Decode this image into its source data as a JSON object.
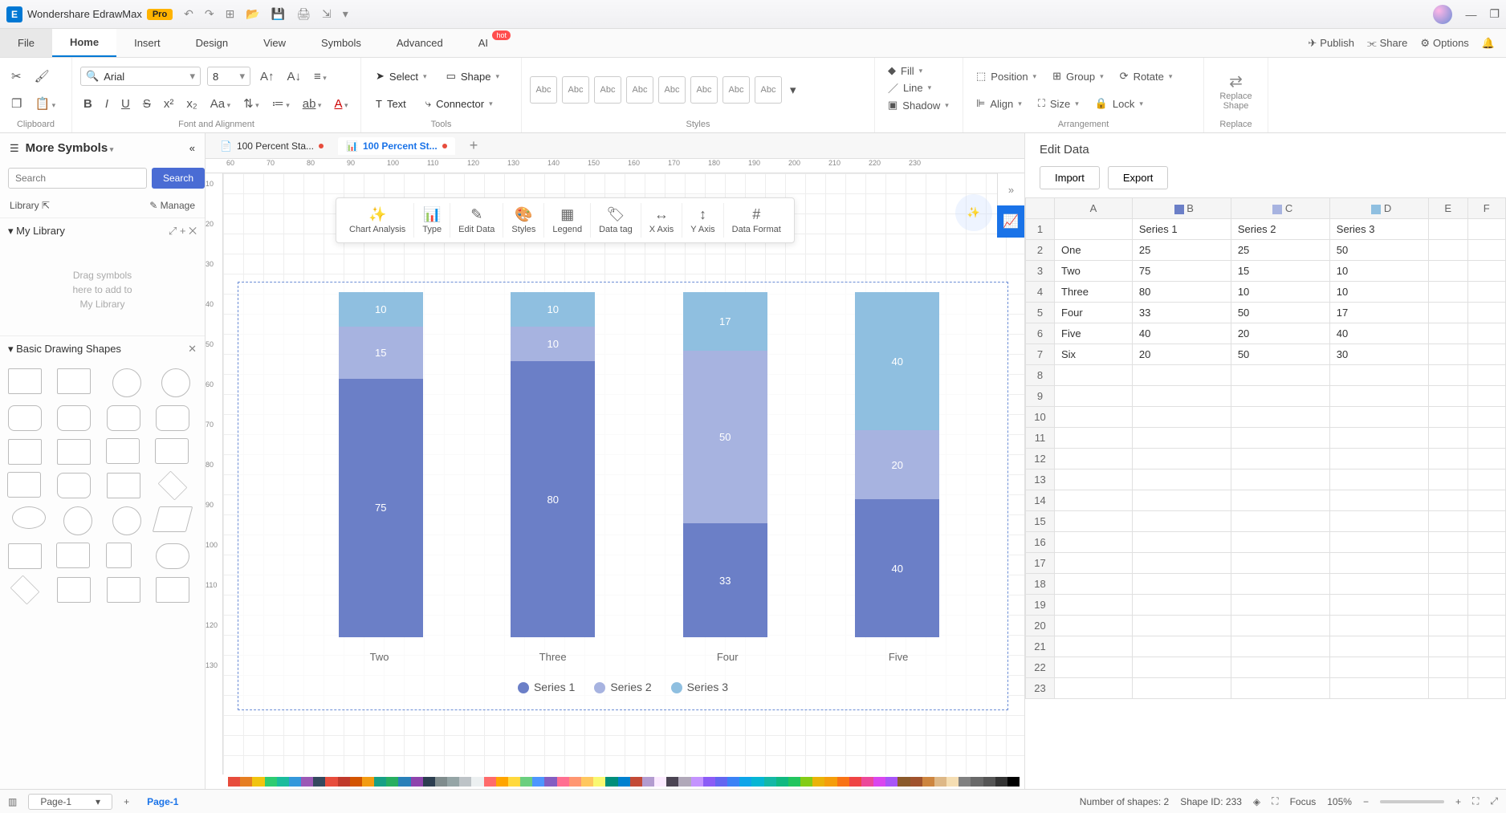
{
  "app": {
    "name": "Wondershare EdrawMax",
    "badge": "Pro"
  },
  "menu": {
    "tabs": [
      "File",
      "Home",
      "Insert",
      "Design",
      "View",
      "Symbols",
      "Advanced",
      "AI"
    ],
    "active": "Home",
    "hot": "hot",
    "right": {
      "publish": "Publish",
      "share": "Share",
      "options": "Options"
    }
  },
  "ribbon": {
    "font_name": "Arial",
    "font_size": "8",
    "select": "Select",
    "shape": "Shape",
    "text": "Text",
    "connector": "Connector",
    "style_label": "Abc",
    "fill": "Fill",
    "line": "Line",
    "shadow": "Shadow",
    "position": "Position",
    "group": "Group",
    "rotate": "Rotate",
    "align": "Align",
    "size": "Size",
    "lock": "Lock",
    "replace_shape": "Replace\nShape",
    "replace": "Replace",
    "groups": {
      "clipboard": "Clipboard",
      "font": "Font and Alignment",
      "tools": "Tools",
      "styles": "Styles",
      "arrange": "Arrangement",
      "rep": "Replace"
    }
  },
  "left": {
    "more": "More Symbols",
    "search_ph": "Search",
    "search_btn": "Search",
    "library": "Library",
    "manage": "Manage",
    "my_library": "My Library",
    "drop_hint": "Drag symbols\nhere to add to\nMy Library",
    "shapes_title": "Basic Drawing Shapes"
  },
  "docs": {
    "tab1": "100 Percent Sta...",
    "tab2": "100 Percent St..."
  },
  "chart_toolbar": [
    "Chart Analysis",
    "Type",
    "Edit Data",
    "Styles",
    "Legend",
    "Data tag",
    "X Axis",
    "Y Axis",
    "Data Format"
  ],
  "ruler_h": [
    "60",
    "70",
    "80",
    "90",
    "100",
    "110",
    "120",
    "130",
    "140",
    "150",
    "160",
    "170",
    "180",
    "190",
    "200",
    "210",
    "220",
    "230"
  ],
  "ruler_v": [
    "10",
    "20",
    "30",
    "40",
    "50",
    "60",
    "70",
    "80",
    "90",
    "100",
    "110",
    "120",
    "130"
  ],
  "chart_data": {
    "type": "stacked-bar-100",
    "categories": [
      "Two",
      "Three",
      "Four",
      "Five"
    ],
    "series": [
      {
        "name": "Series 1",
        "color": "#6b7fc7",
        "values": [
          75,
          80,
          33,
          40
        ]
      },
      {
        "name": "Series 2",
        "color": "#a7b3e0",
        "values": [
          15,
          10,
          50,
          20
        ]
      },
      {
        "name": "Series 3",
        "color": "#8fbfe0",
        "values": [
          10,
          10,
          17,
          40
        ]
      }
    ],
    "legend_position": "bottom"
  },
  "edit_panel": {
    "title": "Edit Data",
    "import": "Import",
    "export": "Export",
    "cols": [
      "A",
      "B",
      "C",
      "D",
      "E",
      "F"
    ],
    "header_row": [
      "",
      "Series 1",
      "Series 2",
      "Series 3"
    ],
    "rows": [
      [
        "One",
        "25",
        "25",
        "50"
      ],
      [
        "Two",
        "75",
        "15",
        "10"
      ],
      [
        "Three",
        "80",
        "10",
        "10"
      ],
      [
        "Four",
        "33",
        "50",
        "17"
      ],
      [
        "Five",
        "40",
        "20",
        "40"
      ],
      [
        "Six",
        "20",
        "50",
        "30"
      ]
    ]
  },
  "status": {
    "page_sel": "Page-1",
    "page_tab": "Page-1",
    "shapes": "Number of shapes: 2",
    "shape_id": "Shape ID: 233",
    "focus": "Focus",
    "zoom": "105%"
  },
  "colors_strip": [
    "#e74c3c",
    "#e67e22",
    "#f1c40f",
    "#2ecc71",
    "#1abc9c",
    "#3498db",
    "#9b59b6",
    "#34495e",
    "#e74c3c",
    "#c0392b",
    "#d35400",
    "#f39c12",
    "#16a085",
    "#27ae60",
    "#2980b9",
    "#8e44ad",
    "#2c3e50",
    "#7f8c8d",
    "#95a5a6",
    "#bdc3c7",
    "#ecf0f1",
    "#ff6b6b",
    "#ffa500",
    "#ffd93d",
    "#6bcf7f",
    "#4d96ff",
    "#845ec2",
    "#ff6f91",
    "#ff9671",
    "#ffc75f",
    "#f9f871",
    "#008f7a",
    "#0081cf",
    "#c34a36",
    "#b39cd0",
    "#fbeaff",
    "#4b4453",
    "#b0a8b9",
    "#c493ff",
    "#8b5cf6",
    "#6366f1",
    "#3b82f6",
    "#0ea5e9",
    "#06b6d4",
    "#14b8a6",
    "#10b981",
    "#22c55e",
    "#84cc16",
    "#eab308",
    "#f59e0b",
    "#f97316",
    "#ef4444",
    "#ec4899",
    "#d946ef",
    "#a855f7",
    "#8b5a2b",
    "#a0522d",
    "#cd853f",
    "#deb887",
    "#f5deb3",
    "#808080",
    "#696969",
    "#555555",
    "#333333",
    "#000000"
  ]
}
